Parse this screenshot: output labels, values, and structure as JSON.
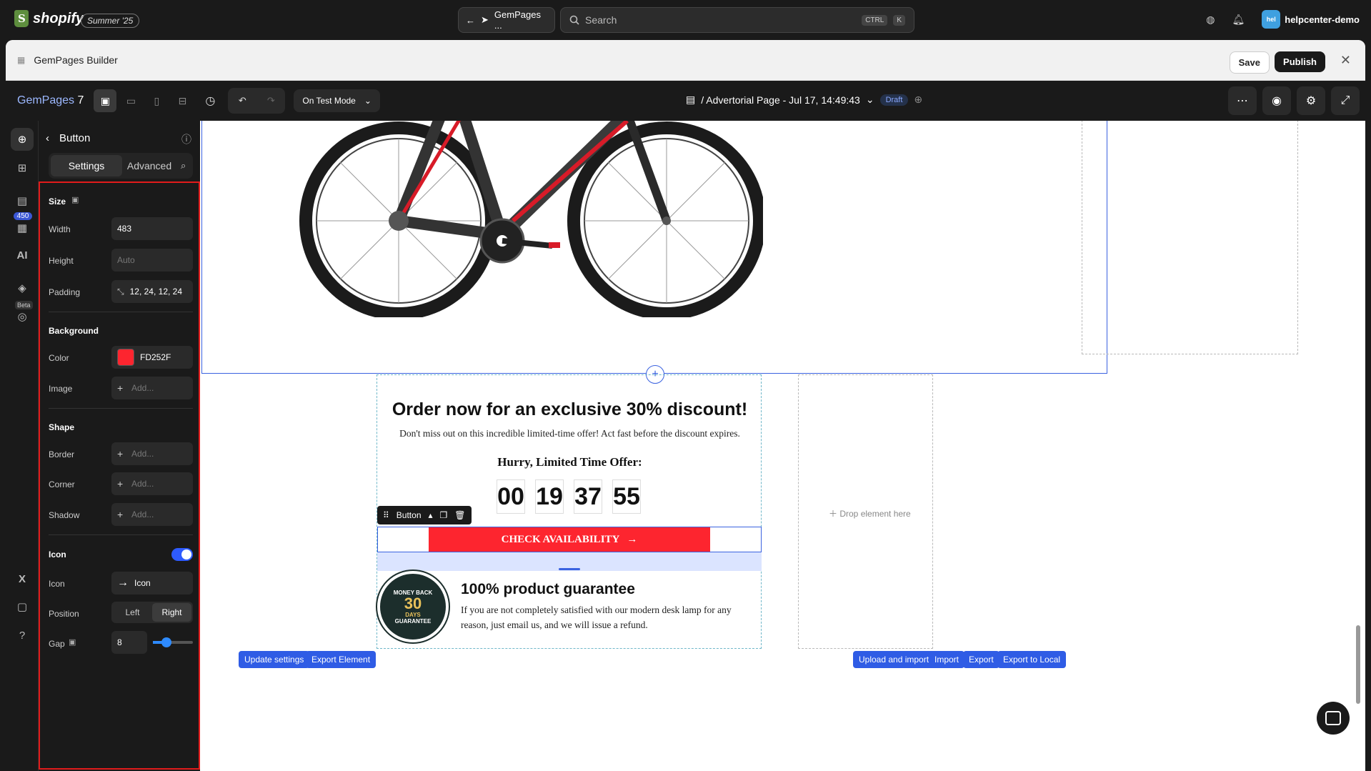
{
  "shopify": {
    "brand": "shopify",
    "edition": "Summer '25",
    "app_pill": "GemPages ...",
    "search_placeholder": "Search",
    "kbd1": "CTRL",
    "kbd2": "K",
    "avatar": "hel",
    "user": "helpcenter-demo"
  },
  "window": {
    "title": "GemPages Builder",
    "save": "Save",
    "publish": "Publish"
  },
  "toolbar": {
    "brand": "GemPages",
    "version": "7",
    "mode": "On Test Mode",
    "page_title": "/ Advertorial Page - Jul 17, 14:49:43",
    "status": "Draft"
  },
  "rail": {
    "badge": "450",
    "ai": "AI",
    "beta": "Beta"
  },
  "panel": {
    "title": "Button",
    "tabs": [
      "Settings",
      "Advanced"
    ],
    "size": {
      "title": "Size",
      "width_label": "Width",
      "width_value": "483",
      "height_label": "Height",
      "height_placeholder": "Auto",
      "padding_label": "Padding",
      "padding_value": "12, 24, 12, 24"
    },
    "background": {
      "title": "Background",
      "color_label": "Color",
      "color_value": "FD252F",
      "color_hex": "#FD252F",
      "image_label": "Image",
      "image_placeholder": "Add..."
    },
    "shape": {
      "title": "Shape",
      "border_label": "Border",
      "border_placeholder": "Add...",
      "corner_label": "Corner",
      "corner_placeholder": "Add...",
      "shadow_label": "Shadow",
      "shadow_placeholder": "Add..."
    },
    "icon": {
      "title": "Icon",
      "enabled": true,
      "icon_label": "Icon",
      "icon_value": "Icon",
      "position_label": "Position",
      "position_options": [
        "Left",
        "Right"
      ],
      "position_selected": "Right",
      "gap_label": "Gap",
      "gap_value": "8"
    }
  },
  "canvas": {
    "offer_title": "Order now for an exclusive 30% discount!",
    "offer_sub": "Don't miss out on this incredible limited-time offer! Act fast before the discount expires.",
    "hurry": "Hurry, Limited Time Offer:",
    "timer": [
      "00",
      "19",
      "37",
      "55"
    ],
    "button_toolbar_label": "Button",
    "cta": "CHECK AVAILABILITY",
    "seal_top": "MONEY BACK",
    "seal_num": "30",
    "seal_days": "DAYS",
    "seal_bottom": "GUARANTEE",
    "guarantee_title": "100% product guarantee",
    "guarantee_text": "If you are not completely satisfied with our modern desk lamp for any reason, just email us, and we will issue a refund.",
    "drop_text": "Drop element here",
    "buttons": {
      "update_settings": "Update settings",
      "export_element": "Export Element",
      "upload_import": "Upload and import",
      "import": "Import",
      "export": "Export",
      "export_local": "Export to Local"
    }
  },
  "colors": {
    "accent": "#2f5ce5",
    "cta_red": "#FD252F",
    "highlight_border": "#e21b1b"
  }
}
